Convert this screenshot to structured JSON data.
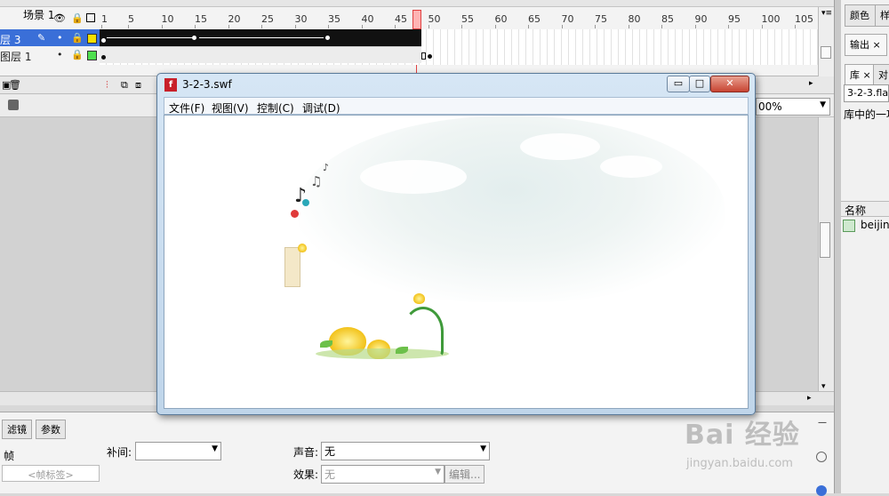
{
  "timeline": {
    "frame_numbers": [
      "1",
      "5",
      "10",
      "15",
      "20",
      "25",
      "30",
      "35",
      "40",
      "45",
      "50",
      "55",
      "60",
      "65",
      "70",
      "75",
      "80",
      "85",
      "90",
      "95",
      "100",
      "105"
    ],
    "layers": [
      {
        "name": "层 3",
        "outline_color": "#f5e000",
        "selected": true
      },
      {
        "name": "图层 1",
        "outline_color": "#4fe04f",
        "selected": false
      }
    ],
    "current_frame": 48
  },
  "scene": {
    "name": "场景 1",
    "zoom": "00%"
  },
  "right_panel": {
    "tabs_top": [
      "颜色",
      "样"
    ],
    "tab_output": "输出",
    "tabs_library": [
      "库",
      "对"
    ],
    "library_file": "3-2-3.fla",
    "library_description": "库中的一项",
    "name_header": "名称",
    "library_item": "beijing"
  },
  "properties": {
    "tabs": [
      "滤镜",
      "参数"
    ],
    "frame_label": "帧",
    "frame_label_placeholder": "<帧标签>",
    "tween_label": "补间:",
    "tween_value": "",
    "sound_label": "声音:",
    "sound_value": "无",
    "effect_label": "效果:",
    "effect_value": "无",
    "edit_button": "编辑..."
  },
  "swf_window": {
    "title": "3-2-3.swf",
    "menus": [
      "文件(F)",
      "视图(V)",
      "控制(C)",
      "调试(D)"
    ],
    "minimize": "▭",
    "maximize": "□",
    "close": "✕"
  },
  "watermark": {
    "brand": "Bai 经验",
    "url": "jingyan.baidu.com"
  }
}
